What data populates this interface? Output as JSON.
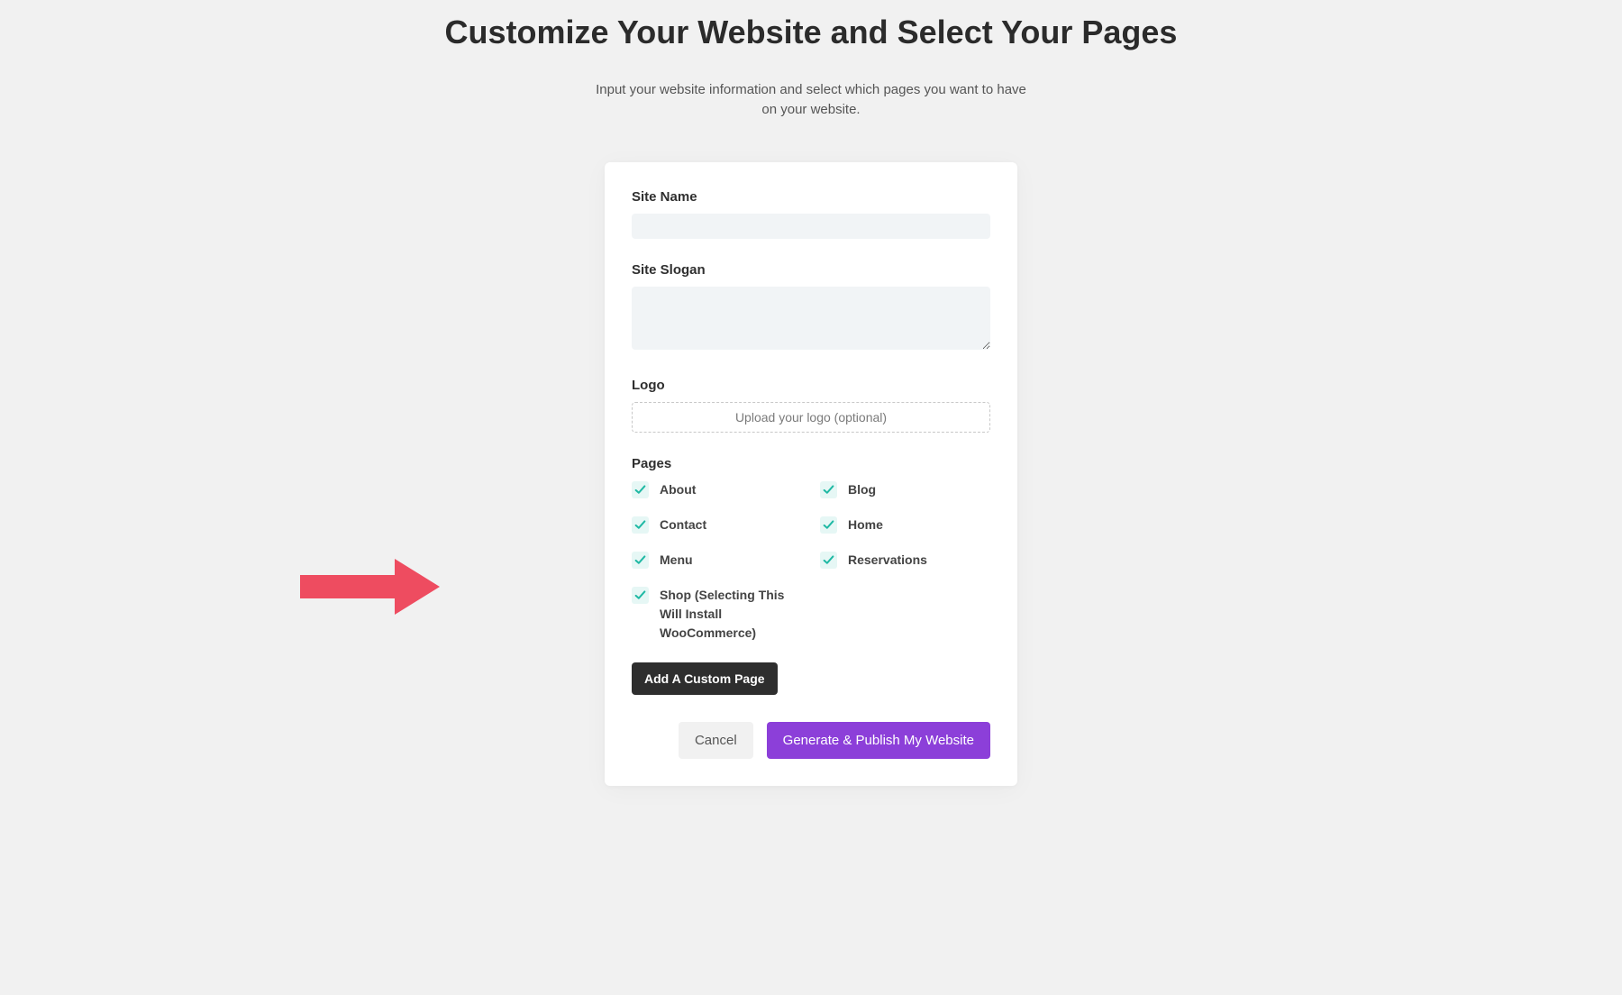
{
  "header": {
    "title": "Customize Your Website and Select Your Pages",
    "subtitle": "Input your website information and select which pages you want to have on your website."
  },
  "form": {
    "site_name_label": "Site Name",
    "site_name_value": "",
    "site_slogan_label": "Site Slogan",
    "site_slogan_value": "",
    "logo_label": "Logo",
    "logo_upload_text": "Upload your logo (optional)",
    "pages_label": "Pages",
    "pages": {
      "about": "About",
      "blog": "Blog",
      "contact": "Contact",
      "home": "Home",
      "menu": "Menu",
      "reservations": "Reservations",
      "shop": "Shop (Selecting This Will Install WooCommerce)"
    },
    "add_custom_page_label": "Add A Custom Page"
  },
  "actions": {
    "cancel_label": "Cancel",
    "generate_label": "Generate & Publish My Website"
  },
  "colors": {
    "accent": "#8c3fd9",
    "checkbox_bg": "#e6f7f5",
    "checkbox_check": "#1fb9a4",
    "arrow": "#ee4c60"
  }
}
